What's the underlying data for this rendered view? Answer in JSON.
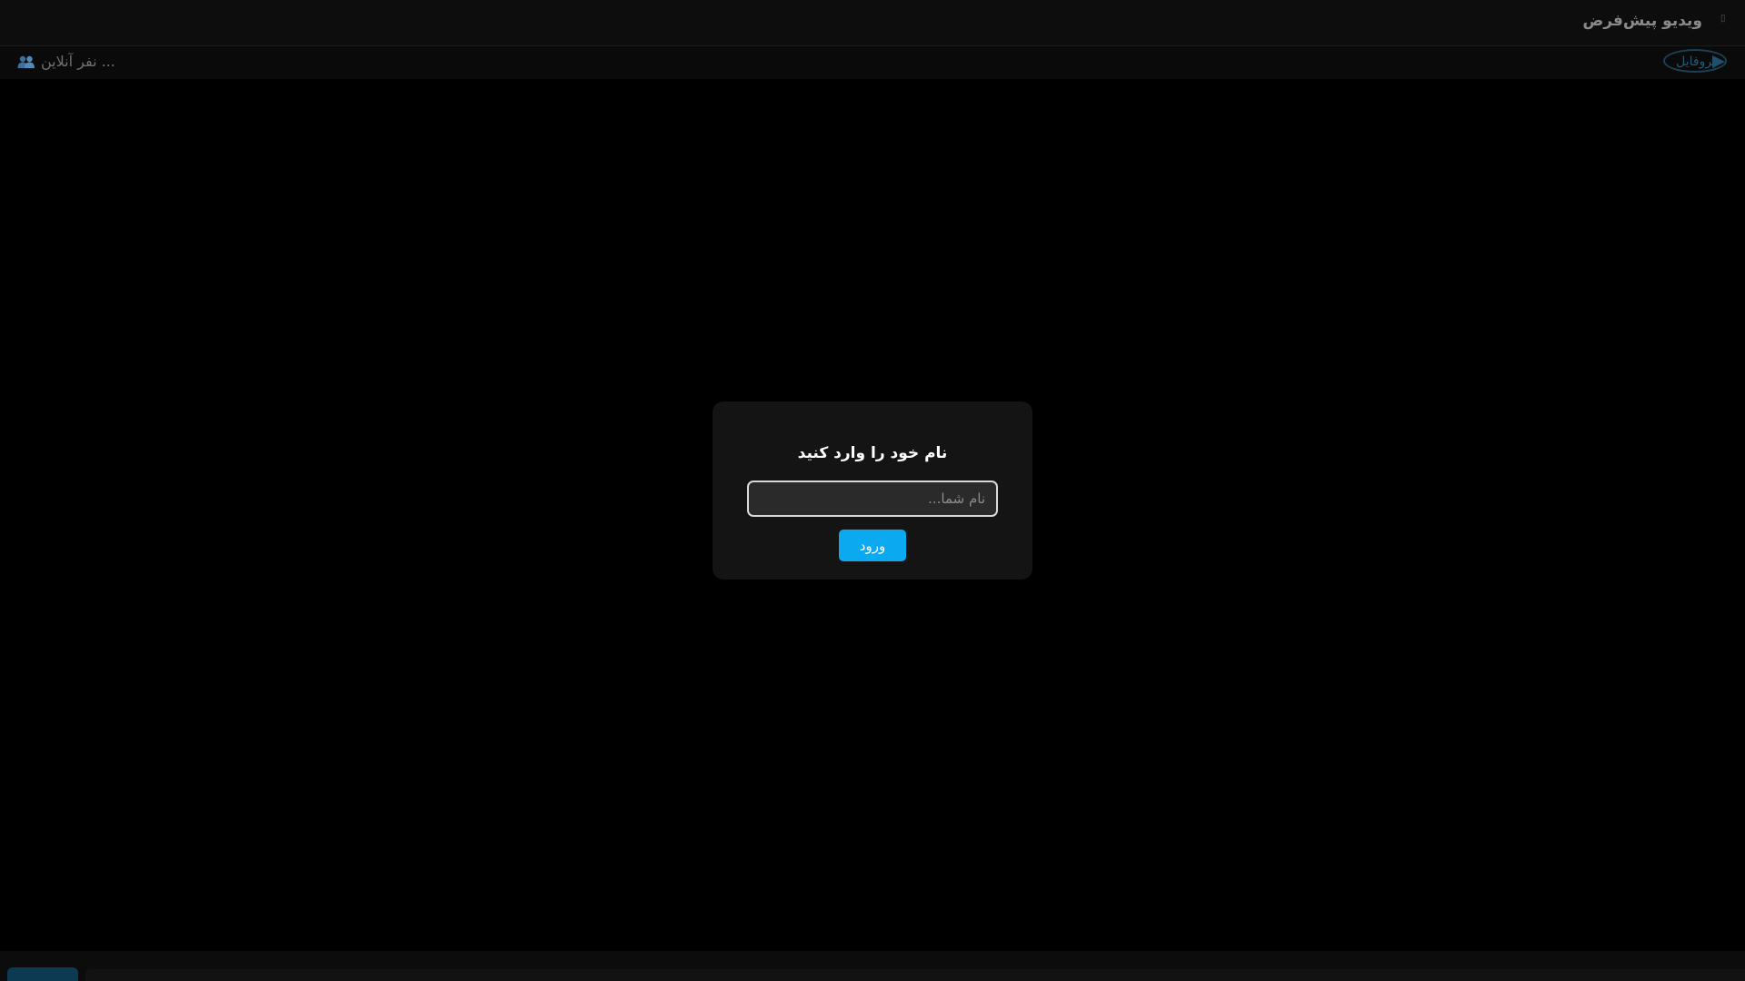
{
  "header": {
    "title": "ویدیو پیش‌فرض",
    "menu_icon": "menu-dot-icon"
  },
  "subheader": {
    "logo_text": "پروفایل",
    "online_text": "... نفر آنلاین",
    "online_icon": "people-icon"
  },
  "modal": {
    "title": "نام خود را وارد کنید",
    "input_placeholder": "نام شما...",
    "input_value": "",
    "enter_label": "ورود"
  },
  "colors": {
    "accent": "#0aa9f0",
    "background": "#000000",
    "modal_background": "#141414"
  }
}
